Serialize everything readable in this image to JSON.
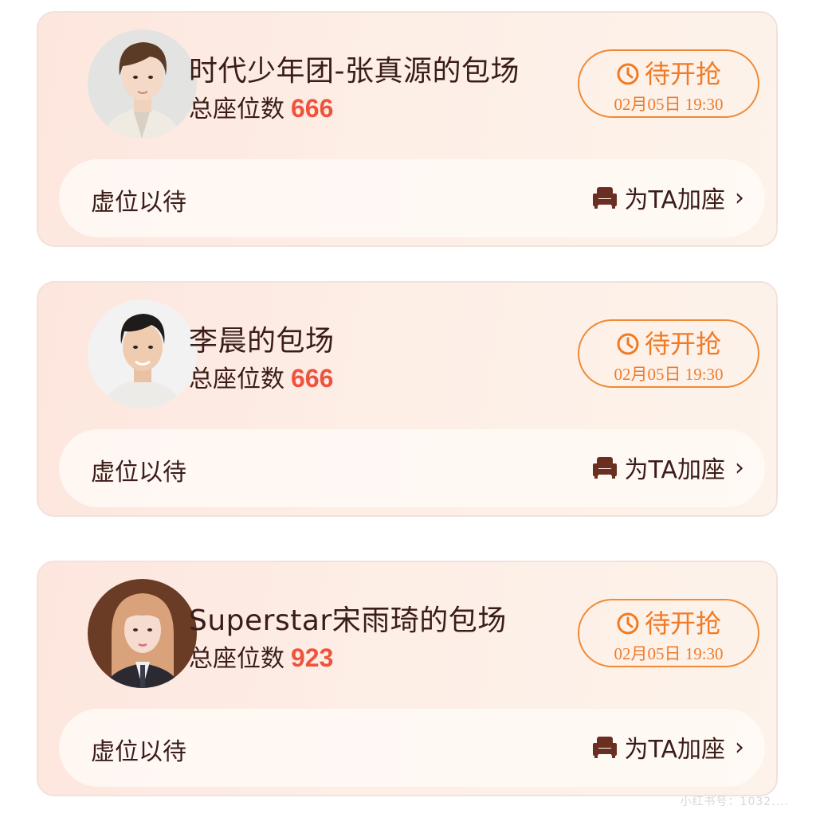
{
  "colors": {
    "accent_orange": "#f07a26",
    "seat_count_red": "#f0533d",
    "text_dark": "#3a1c18",
    "card_bg": "#fde9e0"
  },
  "cards": [
    {
      "title": "时代少年团-张真源的包场",
      "seats_label": "总座位数",
      "seats_value": "666",
      "status_label": "待开抢",
      "status_time": "02月05日 19:30",
      "waiting_label": "虚位以待",
      "add_seat_label": "为TA加座",
      "avatar_icon": "avatar-boy-brown-hair"
    },
    {
      "title": "李晨的包场",
      "seats_label": "总座位数",
      "seats_value": "666",
      "status_label": "待开抢",
      "status_time": "02月05日 19:30",
      "waiting_label": "虚位以待",
      "add_seat_label": "为TA加座",
      "avatar_icon": "avatar-man-black-hair"
    },
    {
      "title": "Superstar宋雨琦的包场",
      "seats_label": "总座位数",
      "seats_value": "923",
      "status_label": "待开抢",
      "status_time": "02月05日 19:30",
      "waiting_label": "虚位以待",
      "add_seat_label": "为TA加座",
      "avatar_icon": "avatar-girl-long-hair"
    }
  ],
  "watermark": "小红书号：1032...."
}
